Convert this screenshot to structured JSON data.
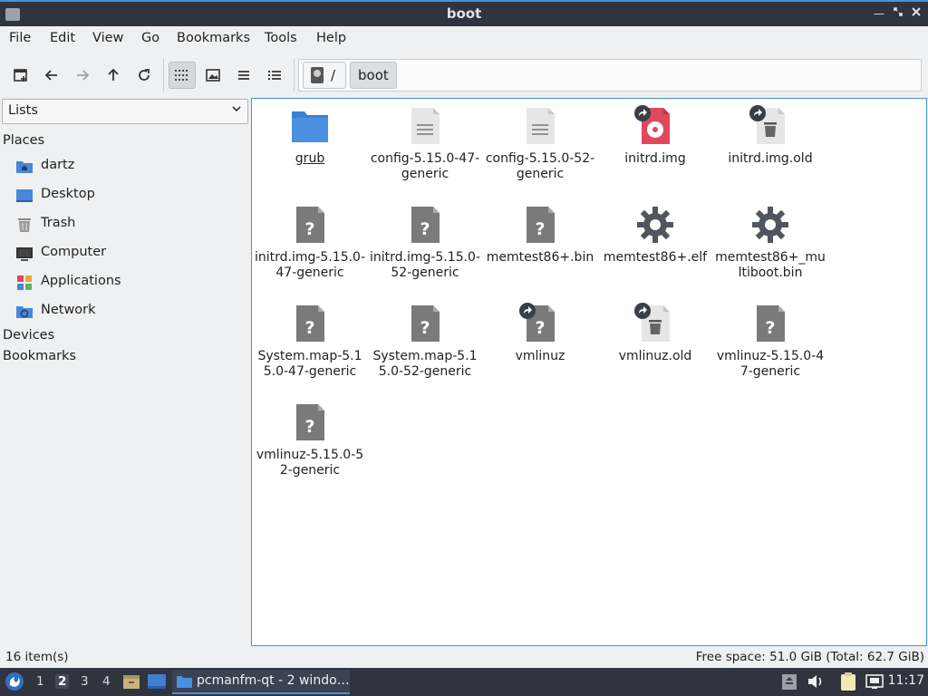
{
  "window": {
    "title": "boot"
  },
  "menu": [
    "File",
    "Edit",
    "View",
    "Go",
    "Bookmarks",
    "Tools",
    "Help"
  ],
  "toolbar": {
    "buttons": [
      "new-tab-icon",
      "back-icon",
      "forward-icon",
      "up-icon",
      "reload-icon",
      "icon-view-icon",
      "thumbnail-view-icon",
      "compact-view-icon",
      "detailed-list-view-icon"
    ],
    "active_view": "icon-view"
  },
  "path": {
    "root": "/",
    "current": "boot"
  },
  "side": {
    "selector": "Lists",
    "places_heading": "Places",
    "places": [
      {
        "label": "dartz",
        "icon": "home-folder-icon"
      },
      {
        "label": "Desktop",
        "icon": "desktop-icon"
      },
      {
        "label": "Trash",
        "icon": "trash-icon"
      },
      {
        "label": "Computer",
        "icon": "computer-icon"
      },
      {
        "label": "Applications",
        "icon": "applications-icon"
      },
      {
        "label": "Network",
        "icon": "network-icon"
      }
    ],
    "devices_heading": "Devices",
    "bookmarks_heading": "Bookmarks"
  },
  "files": [
    {
      "name": "grub",
      "kind": "folder"
    },
    {
      "name": "config-5.15.0-47-generic",
      "kind": "text"
    },
    {
      "name": "config-5.15.0-52-generic",
      "kind": "text"
    },
    {
      "name": "initrd.img",
      "kind": "disc-image-link"
    },
    {
      "name": "initrd.img.old",
      "kind": "broken-link"
    },
    {
      "name": "initrd.img-5.15.0-47-generic",
      "kind": "unknown"
    },
    {
      "name": "initrd.img-5.15.0-52-generic",
      "kind": "unknown"
    },
    {
      "name": "memtest86+.bin",
      "kind": "unknown"
    },
    {
      "name": "memtest86+.elf",
      "kind": "executable"
    },
    {
      "name": "memtest86+_multiboot.bin",
      "kind": "executable"
    },
    {
      "name": "System.map-5.15.0-47-generic",
      "kind": "unknown"
    },
    {
      "name": "System.map-5.15.0-52-generic",
      "kind": "unknown"
    },
    {
      "name": "vmlinuz",
      "kind": "unknown-link"
    },
    {
      "name": "vmlinuz.old",
      "kind": "broken-link"
    },
    {
      "name": "vmlinuz-5.15.0-47-generic",
      "kind": "unknown"
    },
    {
      "name": "vmlinuz-5.15.0-52-generic",
      "kind": "unknown"
    }
  ],
  "status": {
    "items": "16 item(s)",
    "free": "Free space: 51.0 GiB (Total: 62.7 GiB)"
  },
  "taskbar": {
    "workspaces": [
      "1",
      "2",
      "3",
      "4"
    ],
    "active_workspace": "2",
    "task": "pcmanfm-qt - 2 windo…",
    "clock": "11:17"
  },
  "colors": {
    "accent": "#4a90d9",
    "folder": "#4a86d6",
    "file_grey": "#7a7a7a",
    "disc_red": "#e0485c",
    "panel": "#2f343f"
  }
}
